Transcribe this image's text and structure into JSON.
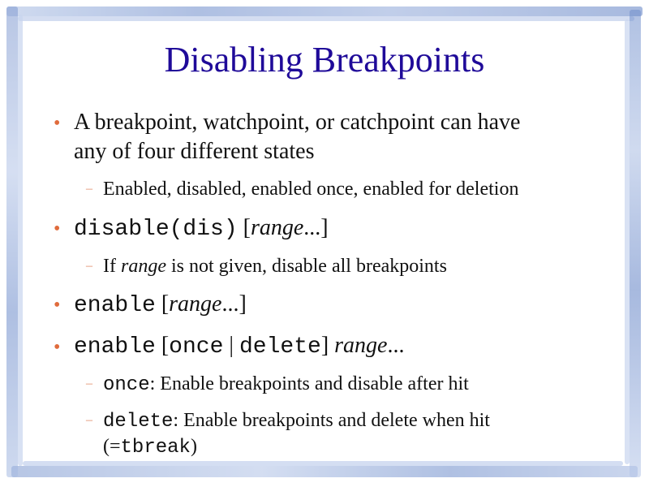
{
  "slide": {
    "title": "Disabling Breakpoints",
    "b1": {
      "line1": "A breakpoint, watchpoint, or catchpoint can have",
      "line2": "any of four different states"
    },
    "b1_sub": "Enabled, disabled, enabled once, enabled for deletion",
    "b2": {
      "code": "disable(dis)",
      "open": "[",
      "arg": "range",
      "ellipsis": "...",
      "close": "]"
    },
    "b2_sub": {
      "pre": "If",
      "arg": "range",
      "post": "is not given, disable all breakpoints"
    },
    "b3": {
      "code": "enable",
      "open": "[",
      "arg": "range",
      "ellipsis": "...",
      "close": "]"
    },
    "b4": {
      "code": "enable",
      "open": "[",
      "once": "once",
      "sep": "|",
      "delete": "delete",
      "close": "]",
      "arg": "range",
      "ellipsis": "..."
    },
    "b4_sub1": {
      "code": "once",
      "text": ": Enable breakpoints and disable after hit"
    },
    "b4_sub2": {
      "code": "delete",
      "text": ": Enable breakpoints and delete when hit",
      "open": "(=",
      "code2": "tbreak",
      "close": ")"
    },
    "bullet_glyph": "•",
    "dash_glyph": "–",
    "colors": {
      "title": "#1f0a99",
      "bullet": "#e06b3c",
      "frame": "#6f8fc9"
    }
  }
}
